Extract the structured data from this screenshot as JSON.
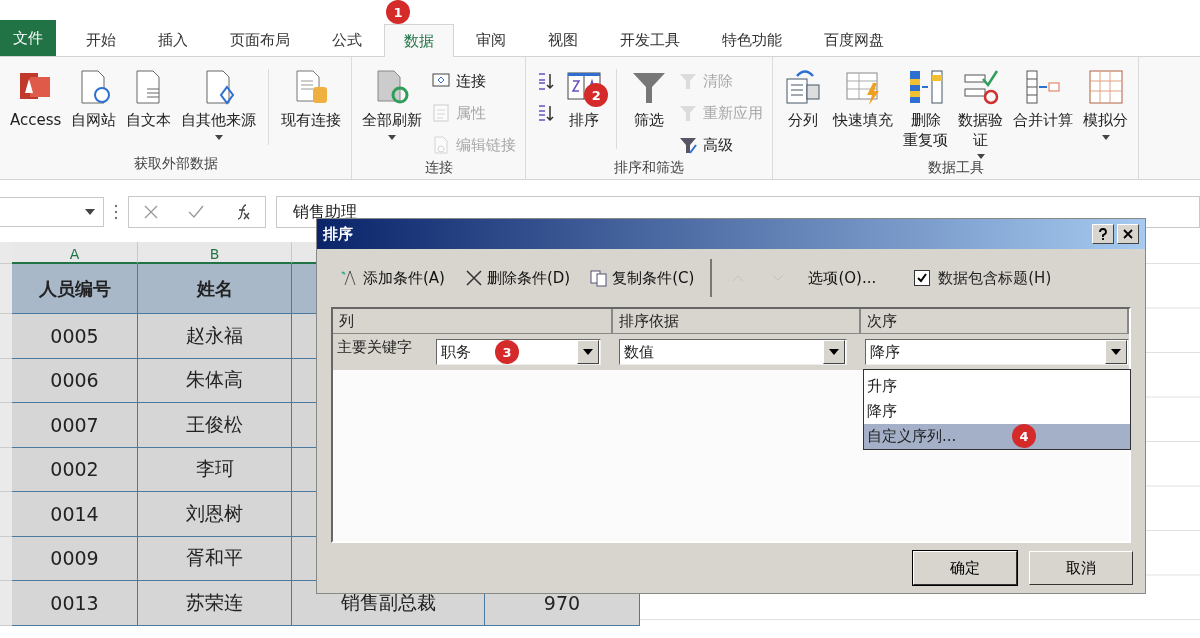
{
  "tabs": [
    {
      "label": "文件",
      "kind": "file",
      "selected": false
    },
    {
      "label": "开始",
      "kind": "tab",
      "selected": false
    },
    {
      "label": "插入",
      "kind": "tab",
      "selected": false
    },
    {
      "label": "页面布局",
      "kind": "tab",
      "selected": false
    },
    {
      "label": "公式",
      "kind": "tab",
      "selected": false
    },
    {
      "label": "数据",
      "kind": "tab",
      "selected": true,
      "badge": "1"
    },
    {
      "label": "审阅",
      "kind": "tab",
      "selected": false
    },
    {
      "label": "视图",
      "kind": "tab",
      "selected": false
    },
    {
      "label": "开发工具",
      "kind": "tab",
      "selected": false
    },
    {
      "label": "特色功能",
      "kind": "tab",
      "selected": false
    },
    {
      "label": "百度网盘",
      "kind": "tab",
      "selected": false
    }
  ],
  "ribbon": {
    "groups": [
      {
        "label": "获取外部数据",
        "items": [
          {
            "kind": "large",
            "lines": [
              "Access"
            ]
          },
          {
            "kind": "large",
            "lines": [
              "自网站"
            ]
          },
          {
            "kind": "large",
            "lines": [
              "自文本"
            ]
          },
          {
            "kind": "large",
            "lines": [
              "自其他来源"
            ],
            "caret": true
          },
          {
            "kind": "divider"
          },
          {
            "kind": "large",
            "lines": [
              "现有连接"
            ]
          }
        ]
      },
      {
        "label": "连接",
        "items": [
          {
            "kind": "large",
            "lines": [
              "全部刷新"
            ],
            "caret": true
          },
          {
            "kind": "stack",
            "entries": [
              {
                "label": "连接",
                "disabled": false
              },
              {
                "label": "属性",
                "disabled": true
              },
              {
                "label": "编辑链接",
                "disabled": true
              }
            ]
          }
        ]
      },
      {
        "label": "排序和筛选",
        "items": [
          {
            "kind": "stack",
            "entries": [
              {
                "kind": "ascending",
                "disabled": false
              },
              {
                "kind": "descending",
                "disabled": false
              }
            ]
          },
          {
            "kind": "large",
            "lines": [
              "排序"
            ],
            "badge": "2"
          },
          {
            "kind": "divider"
          },
          {
            "kind": "large",
            "lines": [
              "筛选"
            ]
          },
          {
            "kind": "stack",
            "entries": [
              {
                "label": "清除",
                "disabled": true
              },
              {
                "label": "重新应用",
                "disabled": true
              },
              {
                "label": "高级",
                "disabled": false
              }
            ]
          }
        ]
      },
      {
        "label": "数据工具",
        "items": [
          {
            "kind": "large",
            "lines": [
              "分列"
            ]
          },
          {
            "kind": "large",
            "lines": [
              "快速填充"
            ]
          },
          {
            "kind": "large",
            "lines": [
              "删除",
              "重复项"
            ]
          },
          {
            "kind": "large",
            "lines": [
              "数据验",
              "证"
            ],
            "caret": true
          },
          {
            "kind": "large",
            "lines": [
              "合并计算"
            ]
          },
          {
            "kind": "large",
            "lines": [
              "模拟分"
            ],
            "caret": true
          }
        ]
      }
    ]
  },
  "formula_bar": {
    "formula": "销售助理"
  },
  "sheet": {
    "columns": [
      "A",
      "B"
    ],
    "rows": [
      {
        "kind": "header",
        "cells": [
          "人员编号",
          "姓名"
        ]
      },
      {
        "kind": "data",
        "cells": [
          "0005",
          "赵永福"
        ]
      },
      {
        "kind": "data",
        "cells": [
          "0006",
          "朱体高"
        ]
      },
      {
        "kind": "data",
        "cells": [
          "0007",
          "王俊松"
        ]
      },
      {
        "kind": "data",
        "cells": [
          "0002",
          "李珂"
        ]
      },
      {
        "kind": "data",
        "cells": [
          "0014",
          "刘恩树"
        ]
      },
      {
        "kind": "data",
        "cells": [
          "0009",
          "胥和平"
        ]
      },
      {
        "kind": "data",
        "cells": [
          "0013",
          "苏荣连",
          "销售副总裁",
          "970"
        ]
      }
    ]
  },
  "dialog": {
    "title": "排序",
    "toolbar": [
      {
        "kind": "add",
        "label": "添加条件(A)",
        "disabled": false
      },
      {
        "kind": "delete",
        "label": "删除条件(D)",
        "disabled": false
      },
      {
        "kind": "copy",
        "label": "复制条件(C)",
        "disabled": false
      },
      {
        "kind": "up",
        "disabled": true
      },
      {
        "kind": "down",
        "disabled": true
      },
      {
        "kind": "options",
        "label": "选项(O)...",
        "disabled": false
      }
    ],
    "header_checkbox": {
      "label": "数据包含标题(H)",
      "checked": true
    },
    "columns": [
      "列",
      "排序依据",
      "次序"
    ],
    "level": {
      "label": "主要关键字",
      "column": "职务",
      "column_badge": "3",
      "sort_on": "数值",
      "order": "降序"
    },
    "order_options": [
      {
        "label": "升序",
        "selected": false
      },
      {
        "label": "降序",
        "selected": false
      },
      {
        "label": "自定义序列...",
        "selected": true,
        "badge": "4"
      }
    ],
    "buttons": [
      "确定",
      "取消"
    ]
  }
}
